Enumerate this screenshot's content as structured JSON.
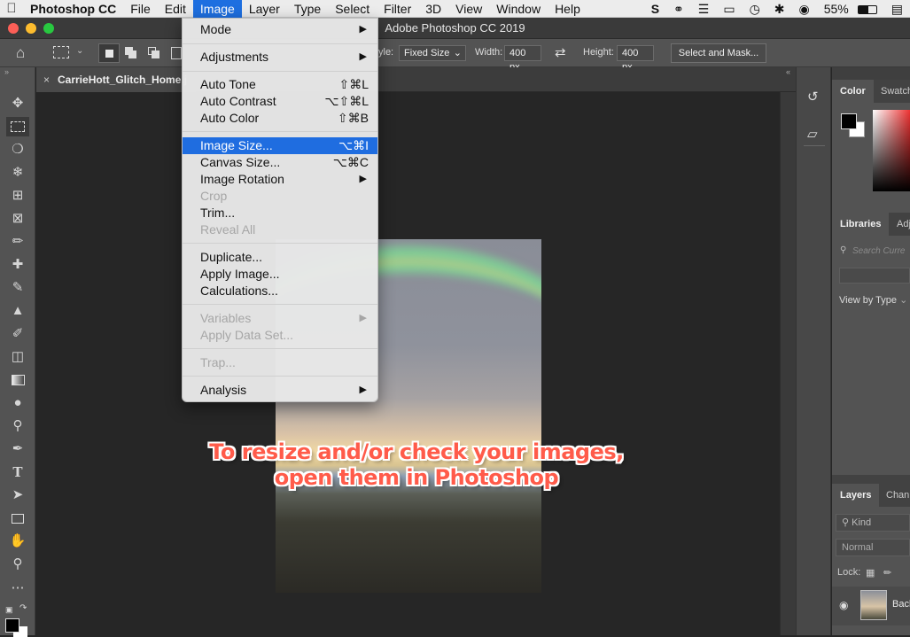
{
  "menubar": {
    "apple": "",
    "items": [
      "Photoshop CC",
      "File",
      "Edit",
      "Image",
      "Layer",
      "Type",
      "Select",
      "Filter",
      "3D",
      "View",
      "Window",
      "Help"
    ],
    "active": "Image",
    "battery": "55%"
  },
  "window": {
    "title": "Adobe Photoshop CC 2019"
  },
  "options": {
    "style_label": "yle:",
    "style_value": "Fixed Size",
    "width_label": "Width:",
    "width_value": "400 px",
    "height_label": "Height:",
    "height_value": "400 px",
    "select_mask": "Select and Mask..."
  },
  "document": {
    "tab_title": "CarrieHott_Glitch_Home.j"
  },
  "image_menu": {
    "mode": "Mode",
    "adjustments": "Adjustments",
    "auto_tone": "Auto Tone",
    "auto_tone_sc": "⇧⌘L",
    "auto_contrast": "Auto Contrast",
    "auto_contrast_sc": "⌥⇧⌘L",
    "auto_color": "Auto Color",
    "auto_color_sc": "⇧⌘B",
    "image_size": "Image Size...",
    "image_size_sc": "⌥⌘I",
    "canvas_size": "Canvas Size...",
    "canvas_size_sc": "⌥⌘C",
    "image_rotation": "Image Rotation",
    "crop": "Crop",
    "trim": "Trim...",
    "reveal_all": "Reveal All",
    "duplicate": "Duplicate...",
    "apply_image": "Apply Image...",
    "calculations": "Calculations...",
    "variables": "Variables",
    "apply_data_set": "Apply Data Set...",
    "trap": "Trap...",
    "analysis": "Analysis"
  },
  "caption": {
    "line1": "To resize and/or check your images,",
    "line2": "open them in Photoshop"
  },
  "right_panel": {
    "color_tab": "Color",
    "swatches_tab": "Swatch",
    "libraries_tab": "Libraries",
    "adj_tab": "Adj",
    "search_placeholder": "Search Curre",
    "view_by": "View by Type",
    "layers_tab": "Layers",
    "channels_tab": "Chan",
    "kind": "Kind",
    "blend_mode": "Normal",
    "lock_label": "Lock:",
    "layer_name": "Back"
  },
  "colors": {
    "accent": "#1f6de0",
    "caption": "#ff5b4a"
  }
}
